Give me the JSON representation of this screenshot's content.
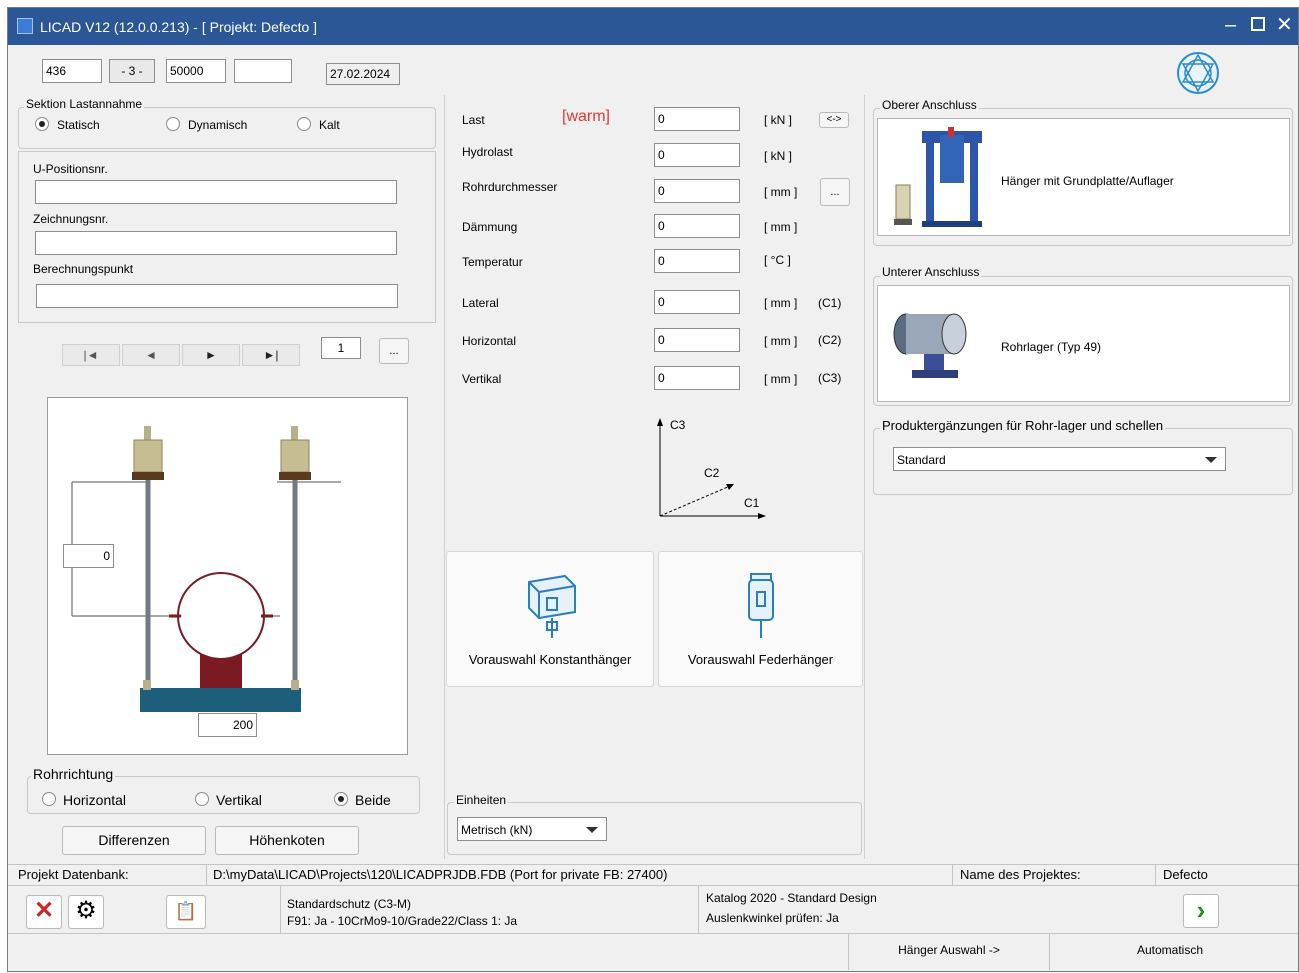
{
  "window": {
    "title": "LICAD V12 (12.0.0.213) -  [ Projekt: Defecto ]"
  },
  "header": {
    "field1": "436",
    "separator": "- 3 -",
    "field2": "50000",
    "field3": "",
    "date": "27.02.2024"
  },
  "sektion": {
    "title": "Sektion Lastannahme",
    "options": [
      "Statisch",
      "Dynamisch",
      "Kalt"
    ],
    "selected": "Statisch"
  },
  "fields": {
    "u_pos_label": "U-Positionsnr.",
    "u_pos_value": "",
    "zeichnung_label": "Zeichnungsnr.",
    "zeichnung_value": "",
    "berechnung_label": "Berechnungspunkt",
    "berechnung_value": ""
  },
  "nav": {
    "first": "|◄",
    "prev": "◄",
    "next": "►",
    "last": "►|",
    "page": "1",
    "more": "..."
  },
  "drawing": {
    "height_value": "0",
    "width_value": "200"
  },
  "rohrrichtung": {
    "title": "Rohrrichtung",
    "options": [
      "Horizontal",
      "Vertikal",
      "Beide"
    ],
    "selected": "Beide"
  },
  "buttons": {
    "differenzen": "Differenzen",
    "hoehenkoten": "Höhenkoten"
  },
  "params": {
    "warm_label": "[warm]",
    "swap_button": "<->",
    "dots_button": "...",
    "rows": [
      {
        "label": "Last",
        "value": "0",
        "unit": "[ kN ]",
        "axis": ""
      },
      {
        "label": "Hydrolast",
        "value": "0",
        "unit": "[ kN ]",
        "axis": ""
      },
      {
        "label": "Rohrdurchmesser",
        "value": "0",
        "unit": "[ mm ]",
        "axis": ""
      },
      {
        "label": "Dämmung",
        "value": "0",
        "unit": "[ mm ]",
        "axis": ""
      },
      {
        "label": "Temperatur",
        "value": "0",
        "unit": "[ °C ]",
        "axis": ""
      },
      {
        "label": "Lateral",
        "value": "0",
        "unit": "[ mm ]",
        "axis": "(C1)"
      },
      {
        "label": "Horizontal",
        "value": "0",
        "unit": "[ mm ]",
        "axis": "(C2)"
      },
      {
        "label": "Vertikal",
        "value": "0",
        "unit": "[ mm ]",
        "axis": "(C3)"
      }
    ]
  },
  "axes": {
    "c3": "C3",
    "c2": "C2",
    "c1": "C1"
  },
  "vorauswahl": {
    "konstant": "Vorauswahl Konstanthänger",
    "feder": "Vorauswahl Federhänger"
  },
  "einheiten": {
    "title": "Einheiten",
    "value": "Metrisch (kN)"
  },
  "oberer": {
    "title": "Oberer Anschluss",
    "value": "Hänger mit Grundplatte/Auflager"
  },
  "unterer": {
    "title": "Unterer Anschluss",
    "value": "Rohrlager (Typ 49)"
  },
  "produkt": {
    "title": "Produktergänzungen für Rohr-lager und schellen",
    "value": "Standard"
  },
  "status": {
    "db_label": "Projekt Datenbank:",
    "db_path": "D:\\myData\\LICAD\\Projects\\120\\LICADPRJDB.FDB (Port for private FB: 27400)",
    "name_label": "Name des Projektes:",
    "name_value": "Defecto",
    "schutz_line1": "Standardschutz (C3-M)",
    "schutz_line2": "F91: Ja - 10CrMo9-10/Grade22/Class 1: Ja",
    "katalog_line1": "Katalog 2020 - Standard Design",
    "katalog_line2": "Auslenkwinkel prüfen: Ja",
    "haenger_button": "Hänger Auswahl ->",
    "auto_button": "Automatisch"
  },
  "colors": {
    "titlebar": "#2b5797",
    "warm": "#e53935",
    "beam": "#1d5f7a",
    "support": "#7a1a22",
    "next_arrow": "#1e8f1e"
  }
}
